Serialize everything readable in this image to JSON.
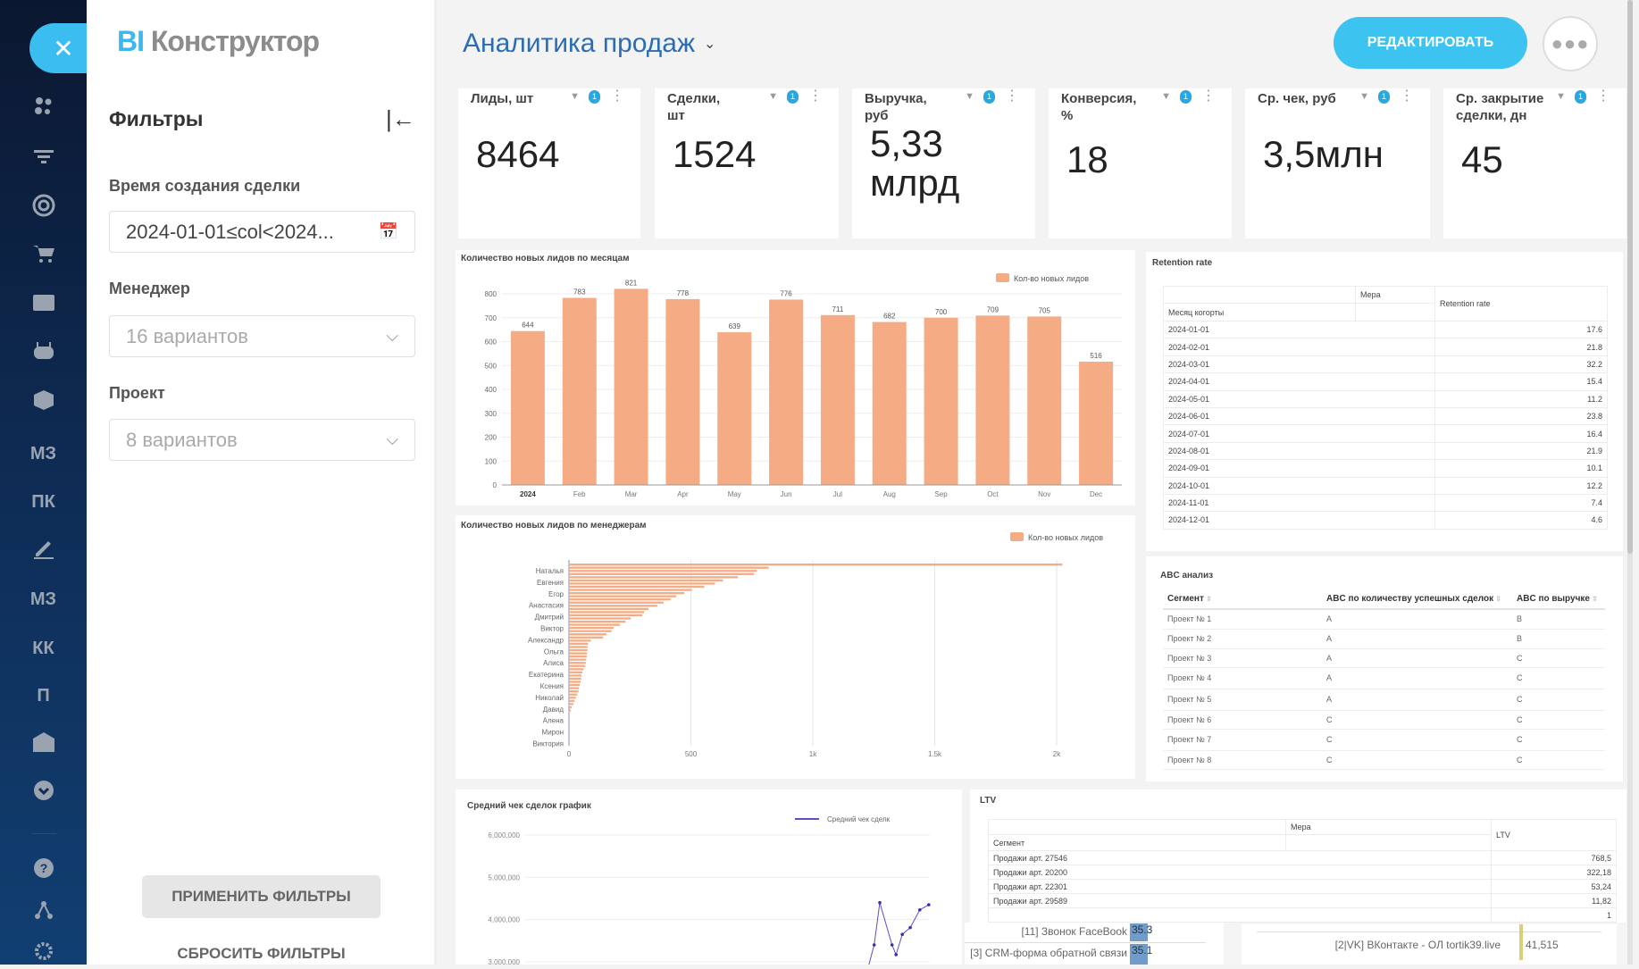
{
  "sidebar": {
    "items": [
      {
        "icon": "team-icon",
        "label": ""
      },
      {
        "icon": "funnel-icon",
        "label": ""
      },
      {
        "icon": "target-icon",
        "label": ""
      },
      {
        "icon": "cart-icon",
        "label": ""
      },
      {
        "icon": "contact-card-icon",
        "label": ""
      },
      {
        "icon": "robot-icon",
        "label": ""
      },
      {
        "icon": "box-icon",
        "label": ""
      },
      {
        "icon": "text-icon",
        "label": "МЗ"
      },
      {
        "icon": "text-icon",
        "label": "ПК"
      },
      {
        "icon": "signature-icon",
        "label": ""
      },
      {
        "icon": "text-icon",
        "label": "МЗ"
      },
      {
        "icon": "text-icon",
        "label": "КК"
      },
      {
        "icon": "text-icon",
        "label": "П"
      },
      {
        "icon": "warehouse-icon",
        "label": ""
      },
      {
        "icon": "chevron-down-circle-icon",
        "label": ""
      },
      {
        "icon": "help-icon",
        "label": ""
      },
      {
        "icon": "hierarchy-icon",
        "label": ""
      },
      {
        "icon": "gear-icon",
        "label": ""
      }
    ]
  },
  "filters": {
    "logo_bi": "BI",
    "logo_rest": "Конструктор",
    "title": "Фильтры",
    "fields": [
      {
        "label": "Время создания сделки",
        "value": "2024-01-01≤col<2024...",
        "placeholder": ""
      },
      {
        "label": "Менеджер",
        "value": "",
        "placeholder": "16 вариантов"
      },
      {
        "label": "Проект",
        "value": "",
        "placeholder": "8 вариантов"
      }
    ],
    "apply": "ПРИМЕНИТЬ ФИЛЬТРЫ",
    "reset": "СБРОСИТЬ ФИЛЬТРЫ"
  },
  "header": {
    "title": "Аналитика продаж",
    "edit": "РЕДАКТИРОВАТЬ"
  },
  "kpis": [
    {
      "label": "Лиды, шт",
      "value": "8464",
      "badge": "1"
    },
    {
      "label": "Сделки, шт",
      "value": "1524",
      "badge": "1"
    },
    {
      "label": "Выручка, руб",
      "value": "5,33 млрд",
      "badge": "1"
    },
    {
      "label": "Конверсия, %",
      "value": "18",
      "badge": "1"
    },
    {
      "label": "Ср. чек, руб",
      "value": "3,5млн",
      "badge": "1"
    },
    {
      "label": "Ср. закрытие сделки, дн",
      "value": "45",
      "badge": "1"
    }
  ],
  "colors": {
    "accent": "#3cc3f0",
    "bar": "#f5ab84",
    "line": "#5b4fc4",
    "title": "#2a6db5"
  },
  "chart_data": [
    {
      "type": "bar",
      "title": "Количество новых лидов по месяцам",
      "categories": [
        "2024",
        "Feb",
        "Mar",
        "Apr",
        "May",
        "Jun",
        "Jul",
        "Aug",
        "Sep",
        "Oct",
        "Nov",
        "Dec"
      ],
      "series": [
        {
          "name": "Кол-во новых лидов",
          "values": [
            644,
            783,
            821,
            778,
            639,
            776,
            711,
            682,
            700,
            709,
            705,
            516
          ]
        }
      ],
      "ylim": [
        0,
        800
      ],
      "yticks": [
        0,
        100,
        200,
        300,
        400,
        500,
        600,
        700,
        800
      ],
      "grid": true,
      "legend": "top-right"
    },
    {
      "type": "bar",
      "orientation": "horizontal",
      "title": "Количество новых лидов по менеджерам",
      "category_tick_labels": [
        "Наталья",
        "Евгения",
        "Егор",
        "Анастасия",
        "Дмитрий",
        "Виктор",
        "Александр",
        "Ольга",
        "Алиса",
        "Екатерина",
        "Ксения",
        "Николай",
        "Давид",
        "Алена",
        "Мирон",
        "Виктория"
      ],
      "series": [
        {
          "name": "Кол-во новых лидов",
          "values": [
            2023,
            819,
            771,
            759,
            693,
            631,
            599,
            555,
            504,
            473,
            440,
            417,
            388,
            362,
            326,
            308,
            301,
            254,
            232,
            209,
            183,
            174,
            154,
            140,
            90,
            78,
            76,
            76,
            74,
            73,
            71,
            69,
            67,
            60,
            55,
            51,
            50,
            48,
            44,
            41,
            39,
            34,
            28,
            23,
            18,
            12,
            7
          ]
        }
      ],
      "xlim": [
        0,
        2000
      ],
      "xticks": [
        "0",
        "500",
        "1k",
        "1.5k",
        "2k"
      ],
      "grid": true,
      "legend": "top-right"
    },
    {
      "type": "line",
      "title": "Средний чек сделок график",
      "series": [
        {
          "name": "Средний чек сделк",
          "values": [
            2900000,
            3400000,
            4400000,
            3400000,
            3170000,
            3650000,
            3810000,
            4230000,
            4350000
          ]
        }
      ],
      "yticks": [
        "6,000,000",
        "5,000,000",
        "4,000,000",
        "3,000,000"
      ],
      "grid": true,
      "legend": "top-right"
    }
  ],
  "retention": {
    "title": "Retention rate",
    "measure": "Мера",
    "row_header": "Месяц когорты",
    "col_header": "Retention rate",
    "rows": [
      [
        "2024-01-01",
        "17.6"
      ],
      [
        "2024-02-01",
        "21.8"
      ],
      [
        "2024-03-01",
        "32.2"
      ],
      [
        "2024-04-01",
        "15.4"
      ],
      [
        "2024-05-01",
        "11.2"
      ],
      [
        "2024-06-01",
        "23.8"
      ],
      [
        "2024-07-01",
        "16.4"
      ],
      [
        "2024-08-01",
        "21.9"
      ],
      [
        "2024-09-01",
        "10.1"
      ],
      [
        "2024-10-01",
        "12.2"
      ],
      [
        "2024-11-01",
        "7.4"
      ],
      [
        "2024-12-01",
        "4.6"
      ]
    ]
  },
  "abc": {
    "title": "ABC анализ",
    "headers": [
      "Сегмент",
      "ABC по количеству успешных сделок",
      "ABC по выручке"
    ],
    "rows": [
      [
        "Проект № 1",
        "A",
        "B"
      ],
      [
        "Проект № 2",
        "A",
        "B"
      ],
      [
        "Проект № 3",
        "A",
        "C"
      ],
      [
        "Проект № 4",
        "A",
        "C"
      ],
      [
        "Проект № 5",
        "A",
        "C"
      ],
      [
        "Проект № 6",
        "C",
        "C"
      ],
      [
        "Проект № 7",
        "C",
        "C"
      ],
      [
        "Проект № 8",
        "C",
        "C"
      ]
    ]
  },
  "ltv": {
    "title": "LTV",
    "measure": "Мера",
    "row_header": "Сегмент",
    "col_header": "LTV",
    "rows": [
      [
        "Продажи арт. 27546",
        "768,5"
      ],
      [
        "Продажи арт. 20200",
        "322,18"
      ],
      [
        "Продажи арт. 22301",
        "53,24"
      ],
      [
        "Продажи арт. 29589",
        "11,82"
      ],
      [
        "",
        "1"
      ]
    ]
  },
  "overlay": {
    "items": [
      {
        "label": "[11] Звонок FaceBook",
        "value": "35.3"
      },
      {
        "label": "[3] CRM-форма обратной связи",
        "value": "35.1"
      },
      {
        "label": "[2|VK] ВКонтакте - ОЛ tortik39.live",
        "value": "41,515"
      }
    ]
  }
}
